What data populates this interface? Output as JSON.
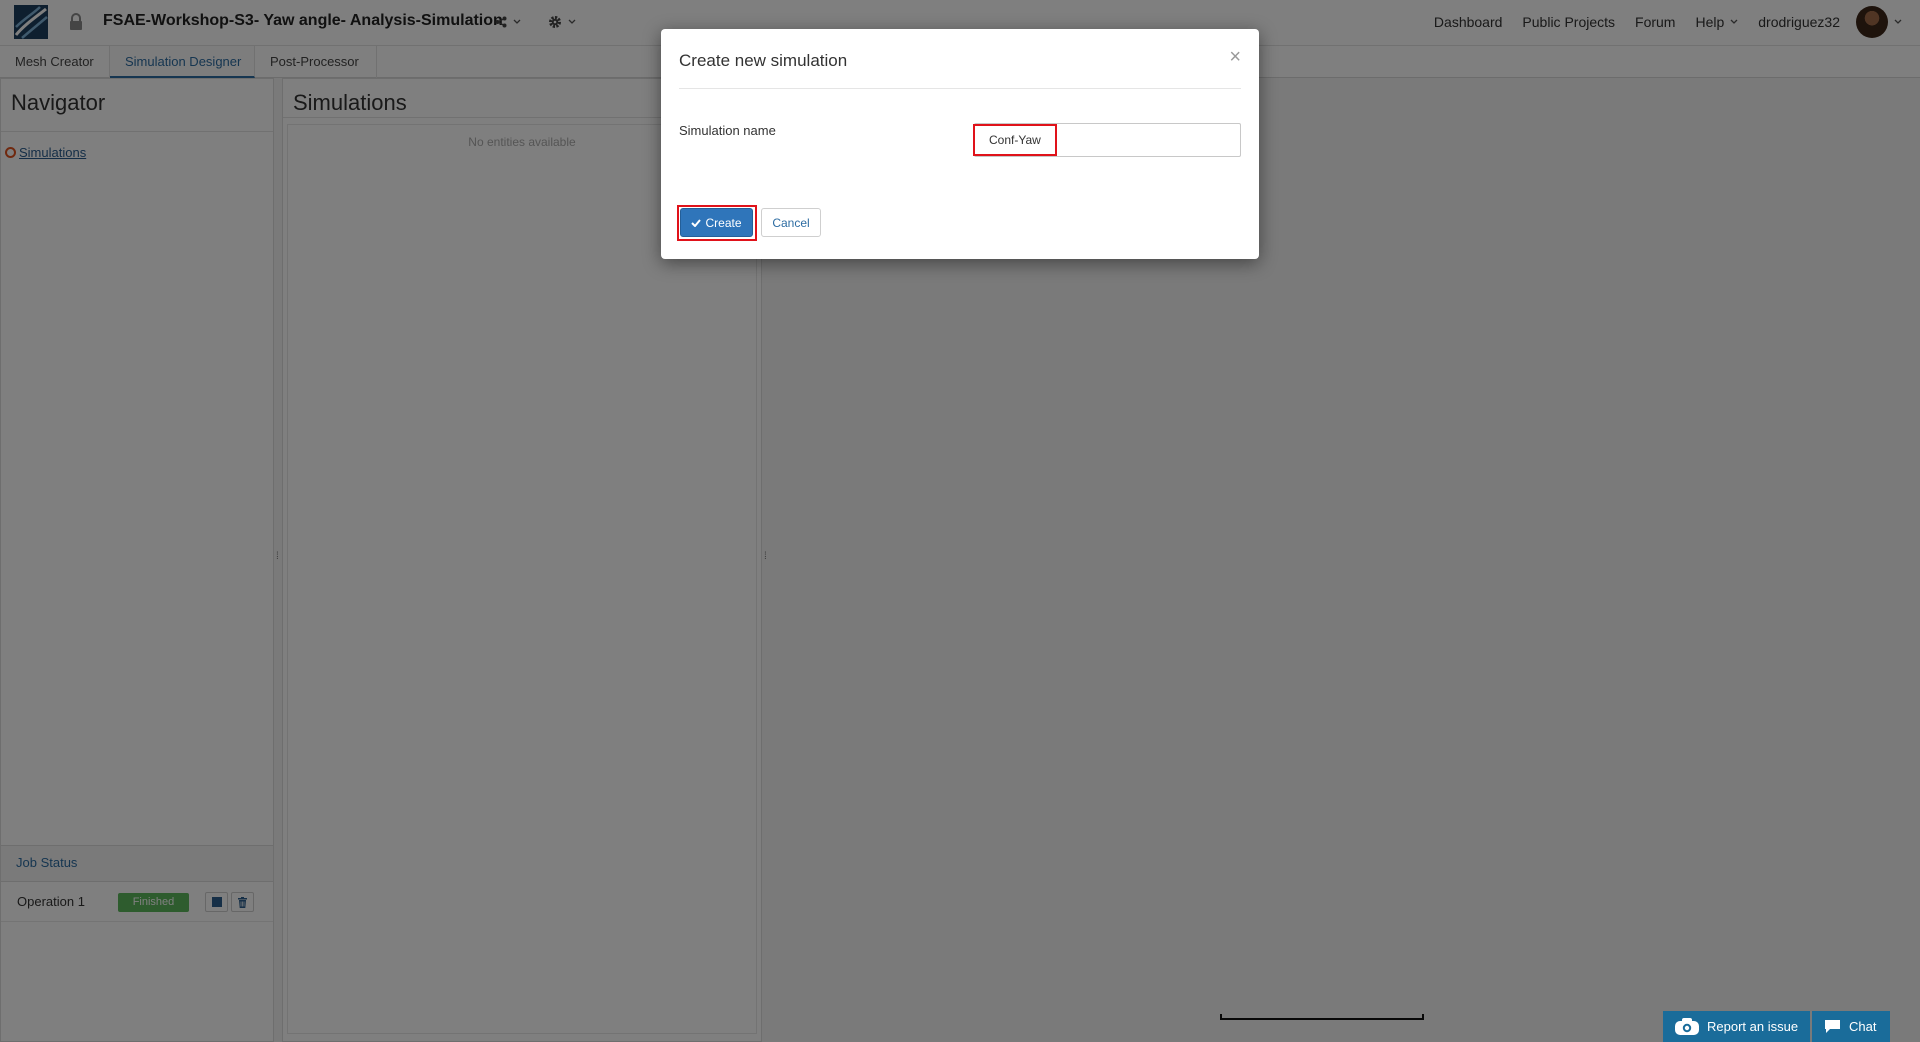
{
  "header": {
    "project_title": "FSAE-Workshop-S3- Yaw angle- Analysis-Simulation",
    "nav": [
      "Dashboard",
      "Public Projects",
      "Forum"
    ],
    "help_label": "Help",
    "username": "drodriguez32"
  },
  "tabs": [
    {
      "label": "Mesh Creator"
    },
    {
      "label": "Simulation Designer"
    },
    {
      "label": "Post-Processor"
    }
  ],
  "navigator": {
    "title": "Navigator",
    "tree_item": "Simulations"
  },
  "job_status": {
    "title": "Job Status",
    "operation": "Operation 1",
    "status": "Finished"
  },
  "simulations": {
    "title": "Simulations",
    "empty_text": "No entities available"
  },
  "modal": {
    "title": "Create new simulation",
    "close": "×",
    "field_label": "Simulation name",
    "input_value": "Conf-Yaw",
    "create_label": "Create",
    "cancel_label": "Cancel"
  },
  "footer": {
    "report_label": "Report an issue",
    "chat_label": "Chat"
  },
  "colors": {
    "accent": "#2d6ca2",
    "primary_button": "#2f75ba",
    "success": "#5cb85c",
    "highlight": "#e0121a",
    "widget": "#1a6c9a"
  }
}
